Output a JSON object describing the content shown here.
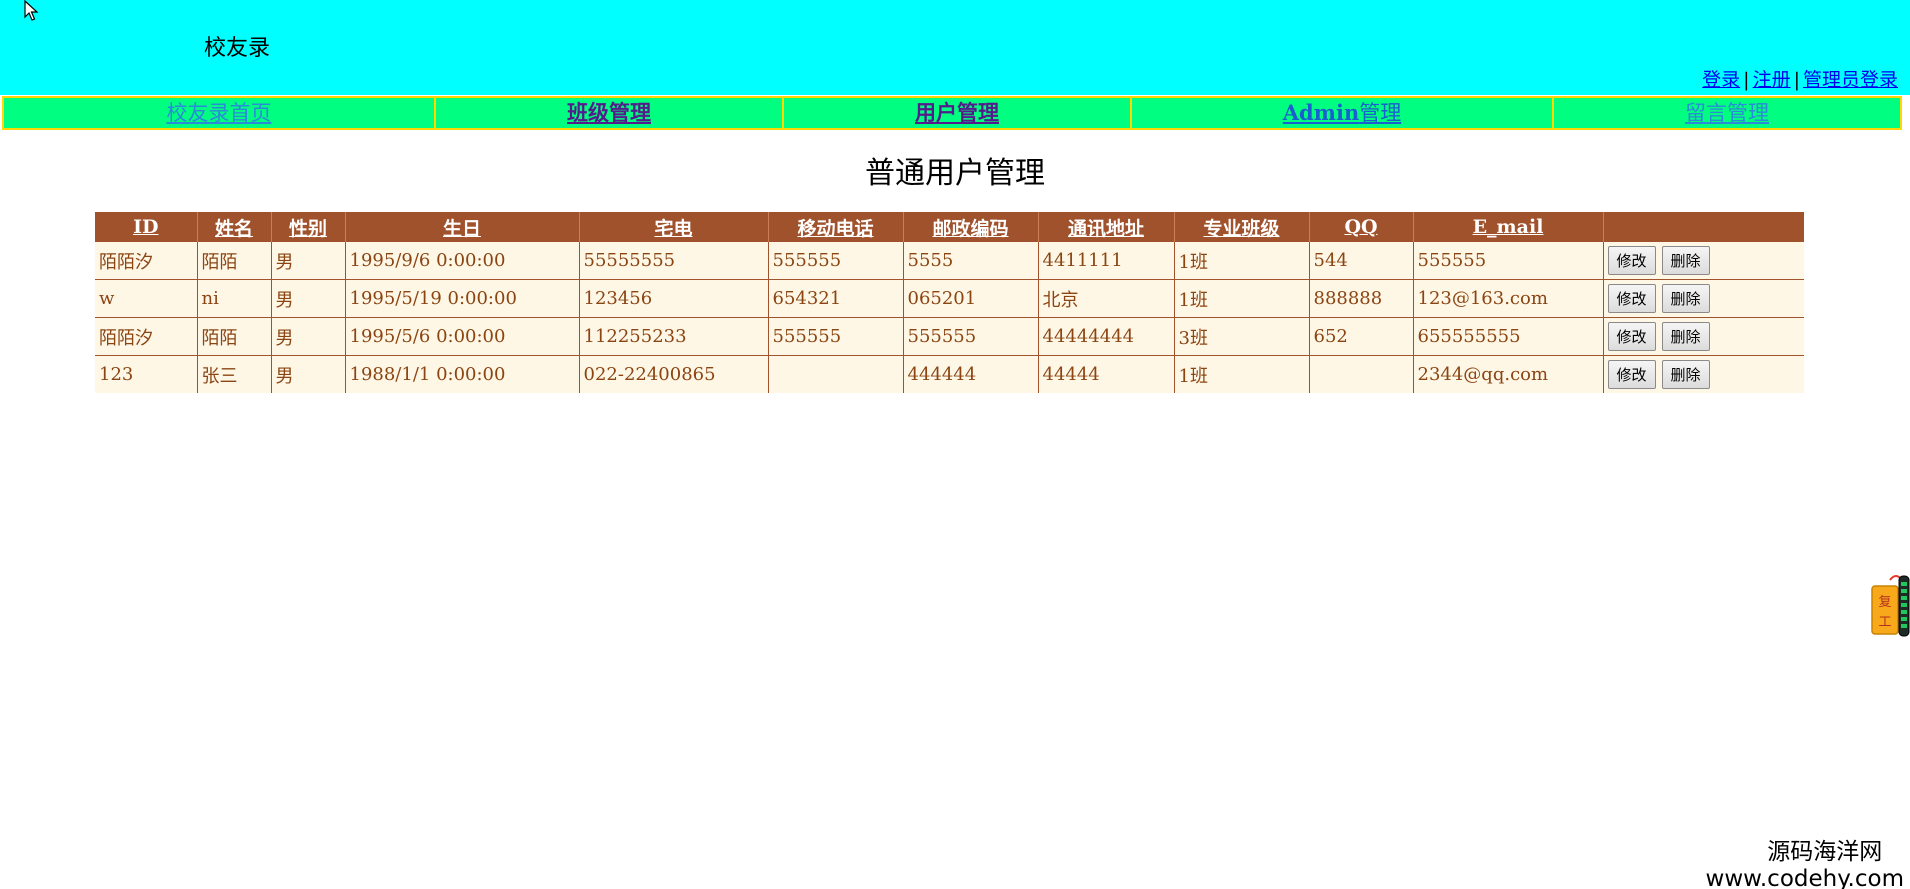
{
  "header": {
    "site_title": "校友录",
    "auth": {
      "login": "登录",
      "separator": "|",
      "register": "注册",
      "admin_login": "管理员登录"
    }
  },
  "nav": {
    "home": "校友录首页",
    "class_mgmt": "班级管理",
    "user_mgmt": "用户管理",
    "admin_mgmt_prefix": "Admin",
    "admin_mgmt_suffix": "管理",
    "message_mgmt": "留言管理"
  },
  "page_title": "普通用户管理",
  "table": {
    "headers": [
      "ID",
      "姓名",
      "性别",
      "生日",
      "宅电",
      "移动电话",
      "邮政编码",
      "通讯地址",
      "专业班级",
      "QQ",
      "E_mail"
    ],
    "rows": [
      [
        "陌陌汐",
        "陌陌",
        "男",
        "1995/9/6 0:00:00",
        "55555555",
        "555555",
        "5555",
        "4411111",
        "1班",
        "544",
        "555555"
      ],
      [
        "w",
        "ni",
        "男",
        "1995/5/19 0:00:00",
        "123456",
        "654321",
        "065201",
        "北京",
        "1班",
        "888888",
        "123@163.com"
      ],
      [
        "陌陌汐",
        "陌陌",
        "男",
        "1995/5/6 0:00:00",
        "112255233",
        "555555",
        "555555",
        "44444444",
        "3班",
        "652",
        "655555555"
      ],
      [
        "123",
        "张三",
        "男",
        "1988/1/1 0:00:00",
        "022-22400865",
        "",
        "444444",
        "44444",
        "1班",
        "",
        "2344@qq.com"
      ]
    ],
    "edit_label": "修改",
    "delete_label": "删除"
  },
  "side_widget_text": "复工",
  "watermark": {
    "name": "源码海洋网",
    "url": "www.codehy.com"
  },
  "colors": {
    "header_bg": "#00ffff",
    "nav_bg": "#00ff80",
    "nav_border": "#ffd800",
    "table_header_bg": "#a0522d",
    "table_row_bg": "#fff7e6",
    "table_text": "#8b4513"
  }
}
